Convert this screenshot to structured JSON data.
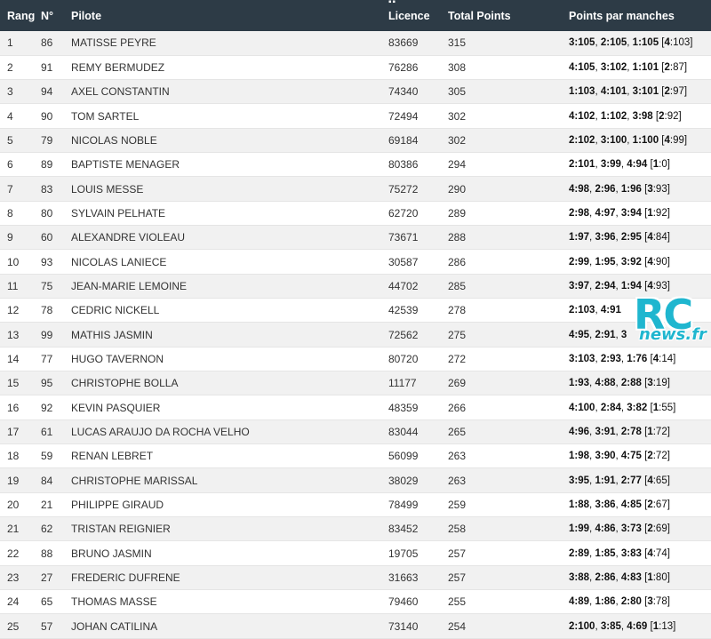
{
  "table": {
    "headers": {
      "rank": "Rang",
      "number": "N°",
      "pilot": "Pilote",
      "license": "Licence",
      "total": "Total Points",
      "heats": "Points par manches"
    },
    "rows": [
      {
        "rank": "1",
        "number": "86",
        "pilot": "MATISSE PEYRE",
        "license": "83669",
        "total": "315",
        "heats": [
          {
            "h": "3",
            "p": "105"
          },
          {
            "h": "2",
            "p": "105"
          },
          {
            "h": "1",
            "p": "105"
          }
        ],
        "dropped": {
          "h": "4",
          "p": "103"
        }
      },
      {
        "rank": "2",
        "number": "91",
        "pilot": "REMY BERMUDEZ",
        "license": "76286",
        "total": "308",
        "heats": [
          {
            "h": "4",
            "p": "105"
          },
          {
            "h": "3",
            "p": "102"
          },
          {
            "h": "1",
            "p": "101"
          }
        ],
        "dropped": {
          "h": "2",
          "p": "87"
        }
      },
      {
        "rank": "3",
        "number": "94",
        "pilot": "AXEL CONSTANTIN",
        "license": "74340",
        "total": "305",
        "heats": [
          {
            "h": "1",
            "p": "103"
          },
          {
            "h": "4",
            "p": "101"
          },
          {
            "h": "3",
            "p": "101"
          }
        ],
        "dropped": {
          "h": "2",
          "p": "97"
        }
      },
      {
        "rank": "4",
        "number": "90",
        "pilot": "TOM SARTEL",
        "license": "72494",
        "total": "302",
        "heats": [
          {
            "h": "4",
            "p": "102"
          },
          {
            "h": "1",
            "p": "102"
          },
          {
            "h": "3",
            "p": "98"
          }
        ],
        "dropped": {
          "h": "2",
          "p": "92"
        }
      },
      {
        "rank": "5",
        "number": "79",
        "pilot": "NICOLAS NOBLE",
        "license": "69184",
        "total": "302",
        "heats": [
          {
            "h": "2",
            "p": "102"
          },
          {
            "h": "3",
            "p": "100"
          },
          {
            "h": "1",
            "p": "100"
          }
        ],
        "dropped": {
          "h": "4",
          "p": "99"
        }
      },
      {
        "rank": "6",
        "number": "89",
        "pilot": "BAPTISTE MENAGER",
        "license": "80386",
        "total": "294",
        "heats": [
          {
            "h": "2",
            "p": "101"
          },
          {
            "h": "3",
            "p": "99"
          },
          {
            "h": "4",
            "p": "94"
          }
        ],
        "dropped": {
          "h": "1",
          "p": "0"
        }
      },
      {
        "rank": "7",
        "number": "83",
        "pilot": "LOUIS MESSE",
        "license": "75272",
        "total": "290",
        "heats": [
          {
            "h": "4",
            "p": "98"
          },
          {
            "h": "2",
            "p": "96"
          },
          {
            "h": "1",
            "p": "96"
          }
        ],
        "dropped": {
          "h": "3",
          "p": "93"
        }
      },
      {
        "rank": "8",
        "number": "80",
        "pilot": "SYLVAIN PELHATE",
        "license": "62720",
        "total": "289",
        "heats": [
          {
            "h": "2",
            "p": "98"
          },
          {
            "h": "4",
            "p": "97"
          },
          {
            "h": "3",
            "p": "94"
          }
        ],
        "dropped": {
          "h": "1",
          "p": "92"
        }
      },
      {
        "rank": "9",
        "number": "60",
        "pilot": "ALEXANDRE VIOLEAU",
        "license": "73671",
        "total": "288",
        "heats": [
          {
            "h": "1",
            "p": "97"
          },
          {
            "h": "3",
            "p": "96"
          },
          {
            "h": "2",
            "p": "95"
          }
        ],
        "dropped": {
          "h": "4",
          "p": "84"
        }
      },
      {
        "rank": "10",
        "number": "93",
        "pilot": "NICOLAS LANIECE",
        "license": "30587",
        "total": "286",
        "heats": [
          {
            "h": "2",
            "p": "99"
          },
          {
            "h": "1",
            "p": "95"
          },
          {
            "h": "3",
            "p": "92"
          }
        ],
        "dropped": {
          "h": "4",
          "p": "90"
        }
      },
      {
        "rank": "11",
        "number": "75",
        "pilot": "JEAN-MARIE LEMOINE",
        "license": "44702",
        "total": "285",
        "heats": [
          {
            "h": "3",
            "p": "97"
          },
          {
            "h": "2",
            "p": "94"
          },
          {
            "h": "1",
            "p": "94"
          }
        ],
        "dropped": {
          "h": "4",
          "p": "93"
        }
      },
      {
        "rank": "12",
        "number": "78",
        "pilot": "CEDRIC NICKELL",
        "license": "42539",
        "total": "278",
        "heats": [
          {
            "h": "2",
            "p": "103"
          },
          {
            "h": "4",
            "p": "91"
          }
        ],
        "dropped": null
      },
      {
        "rank": "13",
        "number": "99",
        "pilot": "MATHIS JASMIN",
        "license": "72562",
        "total": "275",
        "heats": [
          {
            "h": "4",
            "p": "95"
          },
          {
            "h": "2",
            "p": "91"
          }
        ],
        "dropped": null,
        "tail": "3"
      },
      {
        "rank": "14",
        "number": "77",
        "pilot": "HUGO TAVERNON",
        "license": "80720",
        "total": "272",
        "heats": [
          {
            "h": "3",
            "p": "103"
          },
          {
            "h": "2",
            "p": "93"
          },
          {
            "h": "1",
            "p": "76"
          }
        ],
        "dropped": {
          "h": "4",
          "p": "14"
        }
      },
      {
        "rank": "15",
        "number": "95",
        "pilot": "CHRISTOPHE BOLLA",
        "license": "11177",
        "total": "269",
        "heats": [
          {
            "h": "1",
            "p": "93"
          },
          {
            "h": "4",
            "p": "88"
          },
          {
            "h": "2",
            "p": "88"
          }
        ],
        "dropped": {
          "h": "3",
          "p": "19"
        }
      },
      {
        "rank": "16",
        "number": "92",
        "pilot": "KEVIN PASQUIER",
        "license": "48359",
        "total": "266",
        "heats": [
          {
            "h": "4",
            "p": "100"
          },
          {
            "h": "2",
            "p": "84"
          },
          {
            "h": "3",
            "p": "82"
          }
        ],
        "dropped": {
          "h": "1",
          "p": "55"
        }
      },
      {
        "rank": "17",
        "number": "61",
        "pilot": "LUCAS ARAUJO DA ROCHA VELHO",
        "license": "83044",
        "total": "265",
        "heats": [
          {
            "h": "4",
            "p": "96"
          },
          {
            "h": "3",
            "p": "91"
          },
          {
            "h": "2",
            "p": "78"
          }
        ],
        "dropped": {
          "h": "1",
          "p": "72"
        }
      },
      {
        "rank": "18",
        "number": "59",
        "pilot": "RENAN LEBRET",
        "license": "56099",
        "total": "263",
        "heats": [
          {
            "h": "1",
            "p": "98"
          },
          {
            "h": "3",
            "p": "90"
          },
          {
            "h": "4",
            "p": "75"
          }
        ],
        "dropped": {
          "h": "2",
          "p": "72"
        }
      },
      {
        "rank": "19",
        "number": "84",
        "pilot": "CHRISTOPHE MARISSAL",
        "license": "38029",
        "total": "263",
        "heats": [
          {
            "h": "3",
            "p": "95"
          },
          {
            "h": "1",
            "p": "91"
          },
          {
            "h": "2",
            "p": "77"
          }
        ],
        "dropped": {
          "h": "4",
          "p": "65"
        }
      },
      {
        "rank": "20",
        "number": "21",
        "pilot": "PHILIPPE GIRAUD",
        "license": "78499",
        "total": "259",
        "heats": [
          {
            "h": "1",
            "p": "88"
          },
          {
            "h": "3",
            "p": "86"
          },
          {
            "h": "4",
            "p": "85"
          }
        ],
        "dropped": {
          "h": "2",
          "p": "67"
        }
      },
      {
        "rank": "21",
        "number": "62",
        "pilot": "TRISTAN REIGNIER",
        "license": "83452",
        "total": "258",
        "heats": [
          {
            "h": "1",
            "p": "99"
          },
          {
            "h": "4",
            "p": "86"
          },
          {
            "h": "3",
            "p": "73"
          }
        ],
        "dropped": {
          "h": "2",
          "p": "69"
        }
      },
      {
        "rank": "22",
        "number": "88",
        "pilot": "BRUNO JASMIN",
        "license": "19705",
        "total": "257",
        "heats": [
          {
            "h": "2",
            "p": "89"
          },
          {
            "h": "1",
            "p": "85"
          },
          {
            "h": "3",
            "p": "83"
          }
        ],
        "dropped": {
          "h": "4",
          "p": "74"
        }
      },
      {
        "rank": "23",
        "number": "27",
        "pilot": "FREDERIC DUFRENE",
        "license": "31663",
        "total": "257",
        "heats": [
          {
            "h": "3",
            "p": "88"
          },
          {
            "h": "2",
            "p": "86"
          },
          {
            "h": "4",
            "p": "83"
          }
        ],
        "dropped": {
          "h": "1",
          "p": "80"
        }
      },
      {
        "rank": "24",
        "number": "65",
        "pilot": "THOMAS MASSE",
        "license": "79460",
        "total": "255",
        "heats": [
          {
            "h": "4",
            "p": "89"
          },
          {
            "h": "1",
            "p": "86"
          },
          {
            "h": "2",
            "p": "80"
          }
        ],
        "dropped": {
          "h": "3",
          "p": "78"
        }
      },
      {
        "rank": "25",
        "number": "57",
        "pilot": "JOHAN CATILINA",
        "license": "73140",
        "total": "254",
        "heats": [
          {
            "h": "2",
            "p": "100"
          },
          {
            "h": "3",
            "p": "85"
          },
          {
            "h": "4",
            "p": "69"
          }
        ],
        "dropped": {
          "h": "1",
          "p": "13"
        }
      }
    ]
  },
  "watermark": {
    "rc": "RC",
    "news": "news.fr"
  },
  "colors": {
    "header_bg": "#2d3b46",
    "row_alt": "#f1f1f1",
    "watermark": "#1fb6cf"
  }
}
